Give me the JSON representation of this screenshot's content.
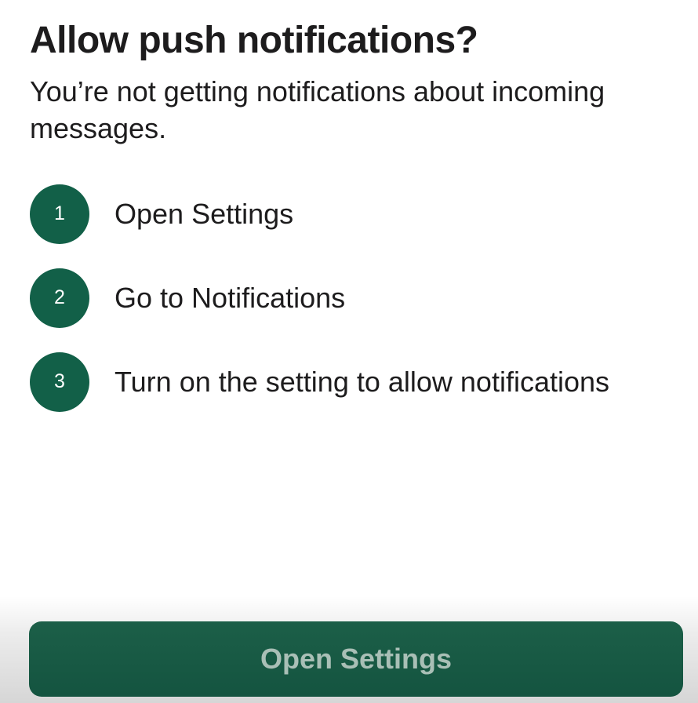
{
  "dialog": {
    "title": "Allow push notifications?",
    "subtitle": "You’re not getting notifications about incoming messages.",
    "steps": [
      {
        "number": "1",
        "text": "Open Settings"
      },
      {
        "number": "2",
        "text": "Go to Notifications"
      },
      {
        "number": "3",
        "text": "Turn on the setting to allow notifications"
      }
    ],
    "primary_button_label": "Open Settings"
  },
  "colors": {
    "accent": "#126048",
    "text": "#1d1c1d",
    "button_text": "#a9bfb6"
  }
}
